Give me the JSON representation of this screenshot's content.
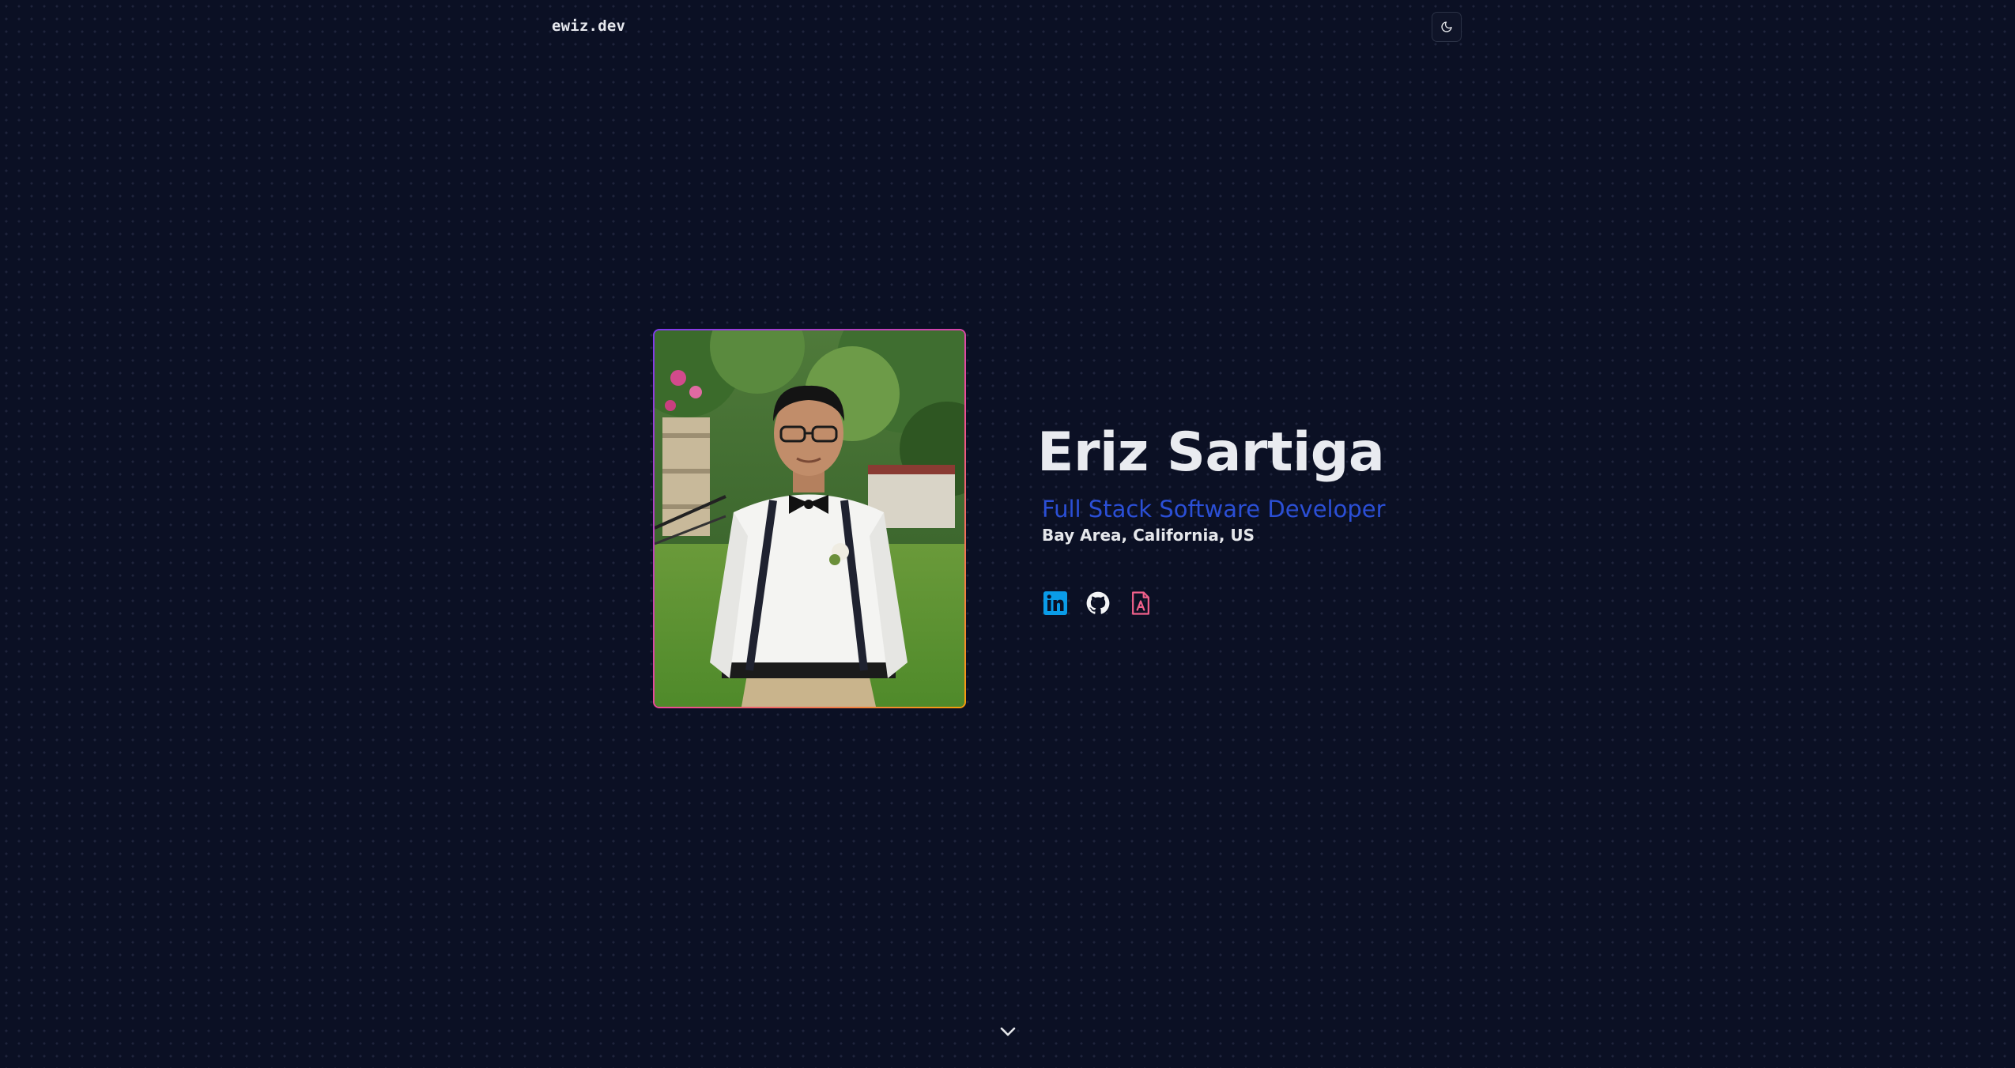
{
  "header": {
    "brand": "ewiz.dev",
    "theme_toggle_icon": "moon-icon"
  },
  "hero": {
    "name": "Eriz Sartiga",
    "role": "Full Stack Software Developer",
    "location": "Bay Area, California, US",
    "photo_alt": "Eriz Sartiga",
    "socials": [
      {
        "icon": "linkedin-icon",
        "color": "#0a9ce8"
      },
      {
        "icon": "github-icon",
        "color": "#f3f4f6"
      },
      {
        "icon": "resume-icon",
        "color": "#f0608a"
      }
    ],
    "scroll_icon": "chevron-down-icon"
  },
  "colors": {
    "background": "#0b1024",
    "accent": "#2b4fd6",
    "text": "#e5e7eb",
    "frame_gradient": [
      "#7c3aed",
      "#ec4899",
      "#f59e0b"
    ]
  }
}
